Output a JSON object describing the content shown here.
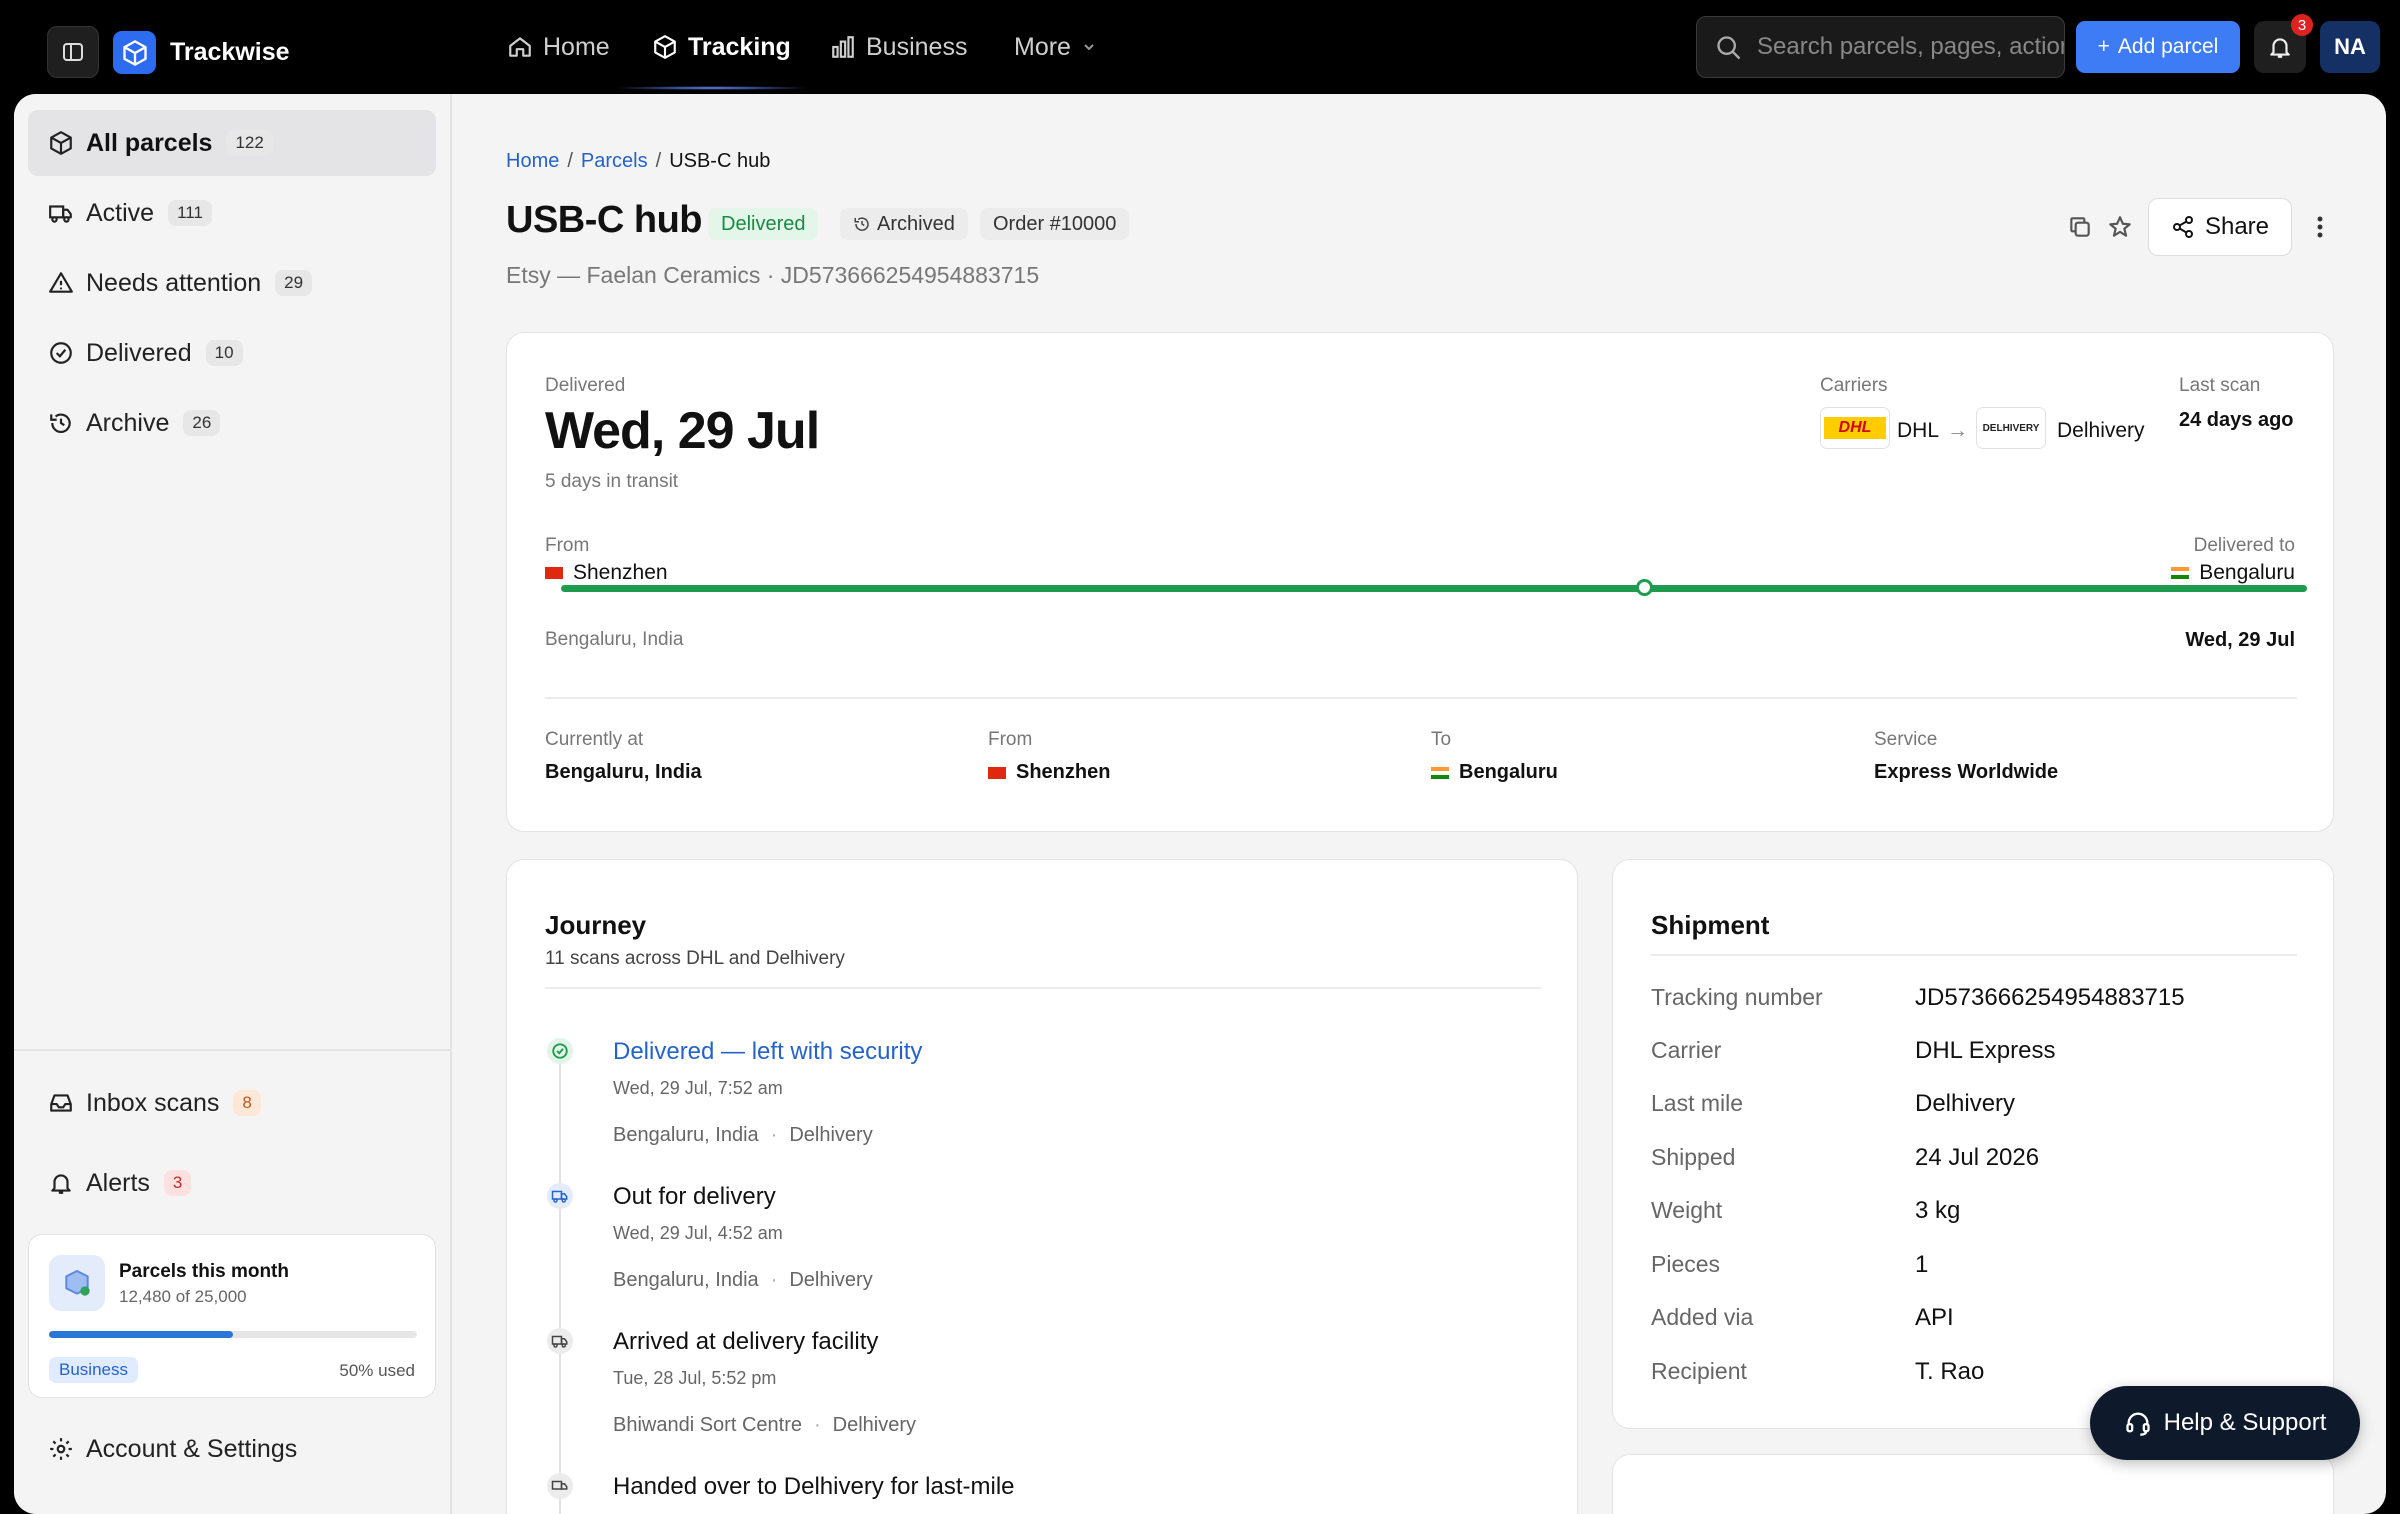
{
  "app": {
    "name": "Trackwise"
  },
  "nav": {
    "home": "Home",
    "tracking": "Tracking",
    "business": "Business",
    "more": "More"
  },
  "search": {
    "placeholder": "Search parcels, pages, actions"
  },
  "actions": {
    "add_parcel": "Add parcel",
    "notifications_count": "3",
    "avatar_initials": "NA"
  },
  "sidebar": {
    "items": [
      {
        "label": "All parcels",
        "count": "122"
      },
      {
        "label": "Active",
        "count": "111"
      },
      {
        "label": "Needs attention",
        "count": "29"
      },
      {
        "label": "Delivered",
        "count": "10"
      },
      {
        "label": "Archive",
        "count": "26"
      }
    ],
    "bottom": [
      {
        "label": "Inbox scans",
        "count": "8"
      },
      {
        "label": "Alerts",
        "count": "3"
      }
    ],
    "usage": {
      "title": "Parcels this month",
      "subtitle": "12,480 of 25,000",
      "progress_percent": 50,
      "plan": "Business",
      "used": "50% used"
    },
    "settings": "Account & Settings"
  },
  "breadcrumb": {
    "home": "Home",
    "parcels": "Parcels",
    "current": "USB-C hub"
  },
  "parcel": {
    "title": "USB-C hub",
    "status": "Delivered",
    "archived": "Archived",
    "order": "Order #10000",
    "subtitle": "Etsy — Faelan Ceramics · JD573666254954883715",
    "share": "Share"
  },
  "summary": {
    "status_label": "Delivered",
    "date": "Wed, 29 Jul",
    "transit": "5 days in transit",
    "carriers_label": "Carriers",
    "carrier_from": "DHL",
    "carrier_to": "Delhivery",
    "carrier_from_logo": "DHL",
    "carrier_to_logo": "DELHIVERY",
    "last_scan_label": "Last scan",
    "last_scan": "24 days ago",
    "from_label": "From",
    "from_city": "Shenzhen",
    "to_label": "Delivered to",
    "to_city": "Bengaluru",
    "current_location": "Bengaluru, India",
    "delivered_date": "Wed, 29 Jul",
    "route_progress": 0.62,
    "details": [
      {
        "label": "Currently at",
        "value": "Bengaluru, India"
      },
      {
        "label": "From",
        "value": "Shenzhen"
      },
      {
        "label": "To",
        "value": "Bengaluru"
      },
      {
        "label": "Service",
        "value": "Express Worldwide"
      }
    ]
  },
  "journey": {
    "title": "Journey",
    "subtitle": "11 scans across DHL and Delhivery",
    "events": [
      {
        "title": "Delivered — left with security",
        "time": "Wed, 29 Jul, 7:52 am",
        "location": "Bengaluru, India",
        "carrier": "Delhivery",
        "icon": "check-circle-icon"
      },
      {
        "title": "Out for delivery",
        "time": "Wed, 29 Jul, 4:52 am",
        "location": "Bengaluru, India",
        "carrier": "Delhivery",
        "icon": "truck-icon"
      },
      {
        "title": "Arrived at delivery facility",
        "time": "Tue, 28 Jul, 5:52 pm",
        "location": "Bhiwandi Sort Centre",
        "carrier": "Delhivery",
        "icon": "truck-icon"
      },
      {
        "title": "Handed over to Delhivery for last-mile",
        "time": "",
        "location": "",
        "carrier": "",
        "icon": "truck-icon"
      }
    ]
  },
  "shipment": {
    "title": "Shipment",
    "rows": [
      {
        "label": "Tracking number",
        "value": "JD573666254954883715"
      },
      {
        "label": "Carrier",
        "value": "DHL Express"
      },
      {
        "label": "Last mile",
        "value": "Delhivery"
      },
      {
        "label": "Shipped",
        "value": "24 Jul 2026"
      },
      {
        "label": "Weight",
        "value": "3 kg"
      },
      {
        "label": "Pieces",
        "value": "1"
      },
      {
        "label": "Added via",
        "value": "API"
      },
      {
        "label": "Recipient",
        "value": "T. Rao"
      }
    ]
  },
  "help": {
    "label": "Help & Support"
  },
  "colors": {
    "accent": "#2563c9",
    "success": "#1e9b4e",
    "brand": "#2d6cf0"
  }
}
